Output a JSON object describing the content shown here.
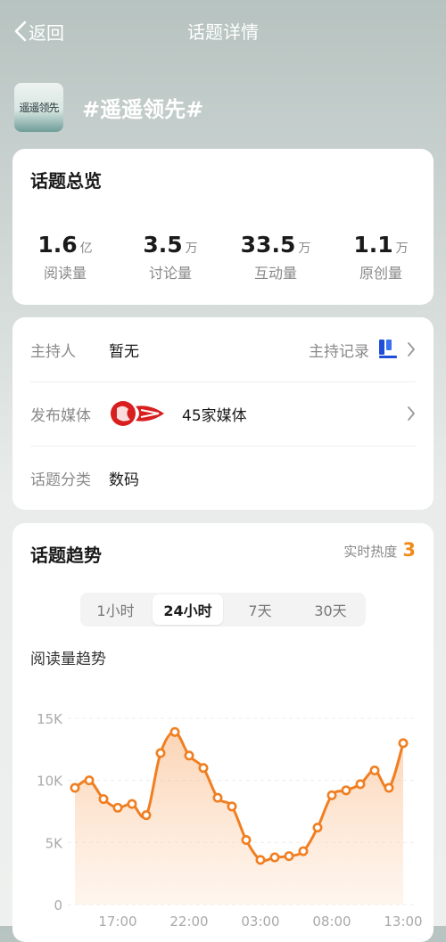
{
  "nav": {
    "back_label": "返回",
    "title": "话题详情"
  },
  "topic": {
    "avatar_text": "遥遥领先",
    "name": "#遥遥领先#"
  },
  "overview": {
    "title": "话题总览",
    "stats": [
      {
        "num": "1.6",
        "unit": "亿",
        "label": "阅读量"
      },
      {
        "num": "3.5",
        "unit": "万",
        "label": "讨论量"
      },
      {
        "num": "33.5",
        "unit": "万",
        "label": "互动量"
      },
      {
        "num": "1.1",
        "unit": "万",
        "label": "原创量"
      }
    ]
  },
  "info": {
    "host_label": "主持人",
    "host_value": "暂无",
    "host_log_label": "主持记录",
    "media_label": "发布媒体",
    "media_value": "45家媒体",
    "category_label": "话题分类",
    "category_value": "数码"
  },
  "trend": {
    "title": "话题趋势",
    "heat_label": "实时热度",
    "heat_value": "3",
    "tabs": [
      "1小时",
      "24小时",
      "7天",
      "30天"
    ],
    "active_tab": "24小时",
    "subtitle": "阅读量趋势"
  },
  "colors": {
    "accent": "#f08a1c",
    "line": "#f07f22"
  },
  "chart_data": {
    "type": "area",
    "title": "阅读量趋势",
    "ylim": [
      0,
      15000
    ],
    "yticks": [
      0,
      5000,
      10000,
      15000
    ],
    "ytick_labels": [
      "0",
      "5K",
      "10K",
      "15K"
    ],
    "x": [
      0,
      1,
      2,
      3,
      4,
      5,
      6,
      7,
      8,
      9,
      10,
      11,
      12,
      13,
      14,
      15,
      16,
      17,
      18,
      19,
      20,
      21,
      22,
      23
    ],
    "xtick_labels": [
      "17:00",
      "22:00",
      "03:00",
      "08:00",
      "13:00"
    ],
    "xtick_positions": [
      3,
      8,
      13,
      18,
      23
    ],
    "values": [
      9400,
      10000,
      8500,
      7800,
      8100,
      7200,
      12200,
      13900,
      12000,
      11000,
      8600,
      7900,
      5200,
      3600,
      3800,
      3900,
      4300,
      6200,
      8800,
      9200,
      9700,
      10800,
      9400,
      13000
    ]
  }
}
